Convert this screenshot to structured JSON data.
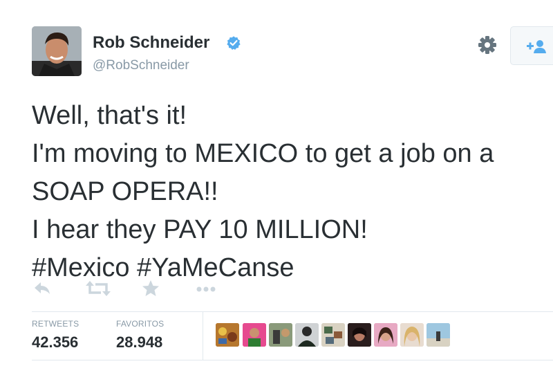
{
  "user": {
    "name": "Rob Schneider",
    "handle": "@RobSchneider"
  },
  "tweet": {
    "lines": [
      "Well, that's it!",
      "I'm moving to MEXICO to get a job on a",
      "SOAP OPERA!!",
      "I hear they PAY 10 MILLION!",
      "#Mexico #YaMeCanse"
    ]
  },
  "stats": {
    "retweets_label": "RETWEETS",
    "retweets_value": "42.356",
    "favorites_label": "FAVORITOS",
    "favorites_value": "28.948"
  },
  "colors": {
    "verified": "#55acee",
    "text": "#292f33",
    "muted": "#8899a6",
    "action_icon": "#ccd6dd"
  },
  "icons": [
    "verified-badge-icon",
    "gear-icon",
    "follow-person-icon",
    "reply-icon",
    "retweet-icon",
    "favorite-star-icon",
    "more-icon"
  ]
}
